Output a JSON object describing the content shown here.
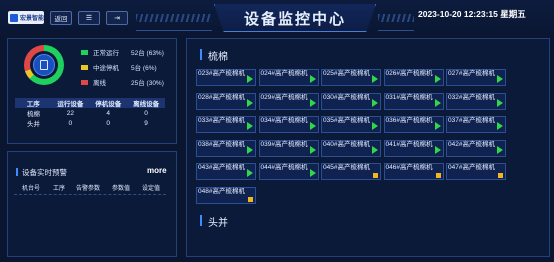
{
  "header": {
    "logo_text": "宏景智能",
    "buttons": [
      {
        "label": "返回",
        "icon": "back-icon"
      },
      {
        "label": "",
        "icon": "list-icon"
      },
      {
        "label": "",
        "icon": "export-icon"
      }
    ],
    "title": "设备监控中心",
    "datetime": "2023-10-20 12:23:15 星期五"
  },
  "overview": {
    "legend": [
      {
        "name": "正常运行",
        "value": "52台 (63%)",
        "color": "#1fd05f"
      },
      {
        "name": "中途停机",
        "value": "5台 (6%)",
        "color": "#e8c62a"
      },
      {
        "name": "离线",
        "value": "25台 (30%)",
        "color": "#e04848"
      }
    ],
    "donut_percentages": [
      63,
      6,
      30
    ],
    "table": {
      "headers": [
        "工序",
        "运行设备",
        "停机设备",
        "离线设备"
      ],
      "rows": [
        [
          "梳棉",
          "22",
          "4",
          "0"
        ],
        [
          "头并",
          "0",
          "0",
          "9"
        ]
      ]
    }
  },
  "alerts": {
    "title": "设备实时预警",
    "more": "more",
    "headers": [
      "机台号",
      "工序",
      "告警参数",
      "参数值",
      "设定值"
    ]
  },
  "machines": {
    "groups": [
      {
        "name": "梳棉",
        "items": [
          {
            "name": "023#高产梳棉机",
            "status": "running"
          },
          {
            "name": "024#高产梳棉机",
            "status": "running"
          },
          {
            "name": "025#高产梳棉机",
            "status": "running"
          },
          {
            "name": "026#高产梳棉机",
            "status": "running"
          },
          {
            "name": "027#高产梳棉机",
            "status": "running"
          },
          {
            "name": "028#高产梳棉机",
            "status": "running"
          },
          {
            "name": "029#高产梳棉机",
            "status": "running"
          },
          {
            "name": "030#高产梳棉机",
            "status": "running"
          },
          {
            "name": "031#高产梳棉机",
            "status": "running"
          },
          {
            "name": "032#高产梳棉机",
            "status": "running"
          },
          {
            "name": "033#高产梳棉机",
            "status": "running"
          },
          {
            "name": "034#高产梳棉机",
            "status": "running"
          },
          {
            "name": "035#高产梳棉机",
            "status": "running"
          },
          {
            "name": "036#高产梳棉机",
            "status": "running"
          },
          {
            "name": "037#高产梳棉机",
            "status": "running"
          },
          {
            "name": "038#高产梳棉机",
            "status": "running"
          },
          {
            "name": "039#高产梳棉机",
            "status": "running"
          },
          {
            "name": "040#高产梳棉机",
            "status": "running"
          },
          {
            "name": "041#高产梳棉机",
            "status": "running"
          },
          {
            "name": "042#高产梳棉机",
            "status": "running"
          },
          {
            "name": "043#高产梳棉机",
            "status": "running"
          },
          {
            "name": "044#高产梳棉机",
            "status": "running"
          },
          {
            "name": "045#高产梳棉机",
            "status": "stopped"
          },
          {
            "name": "046#高产梳棉机",
            "status": "stopped"
          },
          {
            "name": "047#高产梳棉机",
            "status": "stopped"
          },
          {
            "name": "048#高产梳棉机",
            "status": "stopped"
          }
        ]
      },
      {
        "name": "头并",
        "items": []
      }
    ]
  }
}
